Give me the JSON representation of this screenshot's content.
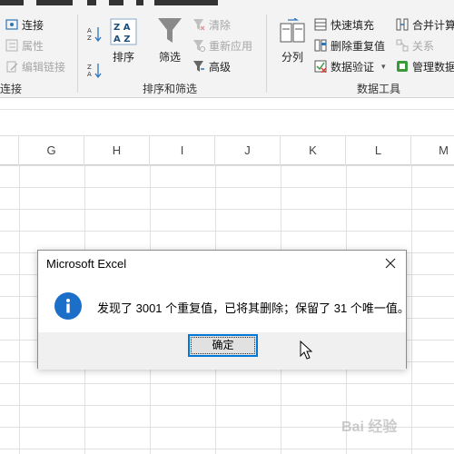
{
  "ribbon": {
    "connections": {
      "group_label": "连接",
      "items": [
        {
          "label": "连接",
          "icon": "connection-icon",
          "enabled": true
        },
        {
          "label": "属性",
          "icon": "properties-icon",
          "enabled": false
        },
        {
          "label": "编辑链接",
          "icon": "edit-links-icon",
          "enabled": false
        }
      ]
    },
    "sort_filter": {
      "group_label": "排序和筛选",
      "sort_az_icon": "sort-ascending-icon",
      "sort_za_icon": "sort-descending-icon",
      "sort_label": "排序",
      "sort_icon_text": "Z A",
      "sort_icon_text2": "A Z",
      "filter_label": "筛选",
      "clear_label": "清除",
      "reapply_label": "重新应用",
      "advanced_label": "高级"
    },
    "data_tools": {
      "group_label": "数据工具",
      "split_label": "分列",
      "flash_fill_label": "快速填充",
      "remove_dup_label": "删除重复值",
      "validation_label": "数据验证",
      "consolidate_label": "合并计算",
      "relationships_label": "关系",
      "manage_model_label": "管理数据"
    }
  },
  "columns": [
    "G",
    "H",
    "I",
    "J",
    "K",
    "L",
    "M"
  ],
  "dialog": {
    "title": "Microsoft Excel",
    "message": "发现了 3001 个重复值，已将其删除；保留了 31 个唯一值。",
    "ok_label": "确定",
    "icon": "info-icon"
  },
  "watermark": "Bai 经验"
}
